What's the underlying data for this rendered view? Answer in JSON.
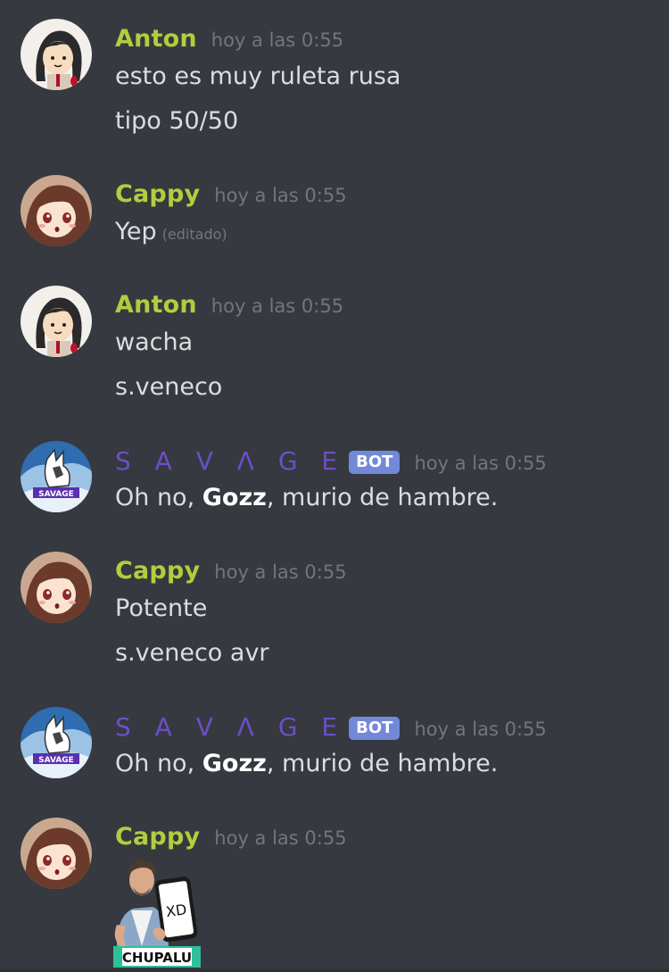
{
  "messages": [
    {
      "author": "Anton",
      "timestamp": "hoy a las 0:55",
      "lines": [
        "esto es muy ruleta rusa",
        "tipo 50/50"
      ]
    },
    {
      "author": "Cappy",
      "timestamp": "hoy a las 0:55",
      "lines": [
        "Yep"
      ],
      "edited": "(editado)"
    },
    {
      "author": "Anton",
      "timestamp": "hoy a las 0:55",
      "lines": [
        "wacha",
        "s.veneco"
      ]
    },
    {
      "author": "S A V Λ G E",
      "bot_tag": "BOT",
      "timestamp": "hoy a las 0:55",
      "text_pre": "Oh no, ",
      "text_bold": "Gozz",
      "text_post": ", murio de hambre."
    },
    {
      "author": "Cappy",
      "timestamp": "hoy a las 0:55",
      "lines": [
        "Potente",
        "s.veneco avr"
      ]
    },
    {
      "author": "S A V Λ G E",
      "bot_tag": "BOT",
      "timestamp": "hoy a las 0:55",
      "text_pre": "Oh no, ",
      "text_bold": "Gozz",
      "text_post": ", murio de hambre."
    },
    {
      "author": "Cappy",
      "timestamp": "hoy a las 0:55",
      "sticker": {
        "phone_text": "XD",
        "caption": "CHUPALU"
      }
    }
  ],
  "colors": {
    "background": "#36393f",
    "username": "#b4cc3e",
    "bot_name": "#6c4fc7",
    "bot_tag": "#7289da",
    "timestamp": "#72767d",
    "text": "#dcddde"
  }
}
